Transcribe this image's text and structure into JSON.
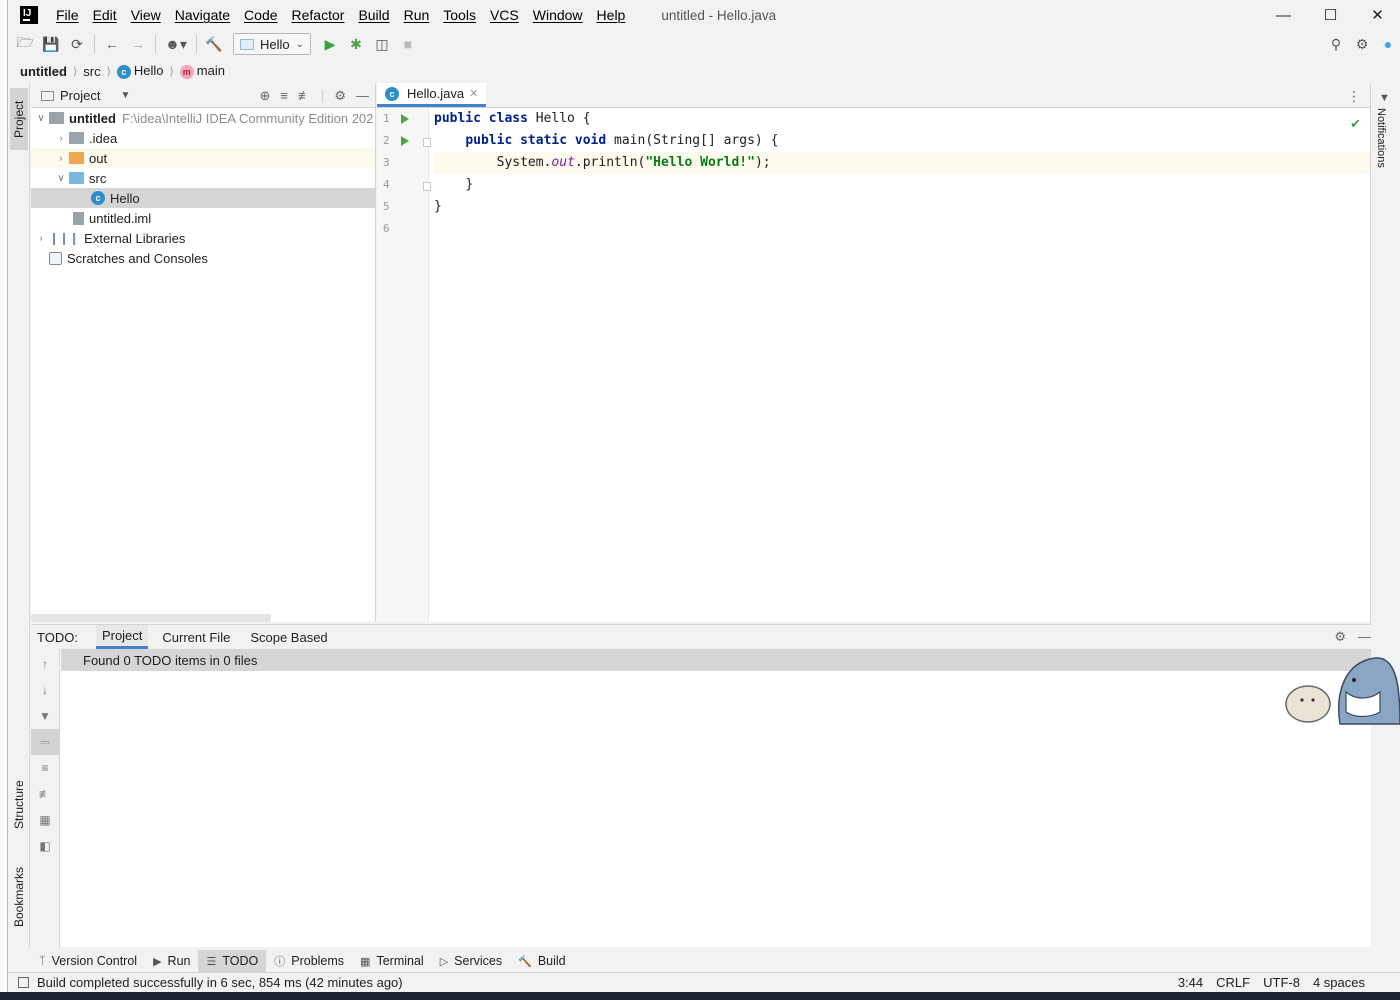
{
  "window": {
    "title": "untitled - Hello.java"
  },
  "menu": [
    "File",
    "Edit",
    "View",
    "Navigate",
    "Code",
    "Refactor",
    "Build",
    "Run",
    "Tools",
    "VCS",
    "Window",
    "Help"
  ],
  "toolbar": {
    "run_config": "Hello"
  },
  "breadcrumb": {
    "project": "untitled",
    "folder": "src",
    "class": "Hello",
    "method": "main"
  },
  "project_panel": {
    "title": "Project",
    "tree": [
      {
        "label": "untitled",
        "path": "F:\\idea\\IntelliJ IDEA Community Edition 202",
        "indent": 0
      },
      {
        "label": ".idea",
        "indent": 1
      },
      {
        "label": "out",
        "indent": 1
      },
      {
        "label": "src",
        "indent": 1
      },
      {
        "label": "Hello",
        "indent": 2
      },
      {
        "label": "untitled.iml",
        "indent": 1
      },
      {
        "label": "External Libraries",
        "indent": 0
      },
      {
        "label": "Scratches and Consoles",
        "indent": 0
      }
    ]
  },
  "editor": {
    "tab": "Hello.java",
    "line_numbers": [
      "1",
      "2",
      "3",
      "4",
      "5",
      "6"
    ],
    "code": {
      "l1_kw": "public class",
      "l1_rest": " Hello {",
      "l2_kw": "public static void",
      "l2_rest": " main(String[] args) {",
      "l3_a": "System.",
      "l3_field": "out",
      "l3_b": ".println(",
      "l3_str": "\"Hello World!\"",
      "l3_c": ");",
      "l4": "}",
      "l5": "}"
    }
  },
  "side_tabs": {
    "project": "Project",
    "structure": "Structure",
    "bookmarks": "Bookmarks",
    "notifications": "Notifications"
  },
  "todo": {
    "label": "TODO:",
    "tabs": [
      "Project",
      "Current File",
      "Scope Based"
    ],
    "result": "Found 0 TODO items in 0 files"
  },
  "bottom_tabs": [
    "Version Control",
    "Run",
    "TODO",
    "Problems",
    "Terminal",
    "Services",
    "Build"
  ],
  "status": {
    "message": "Build completed successfully in 6 sec, 854 ms (42 minutes ago)",
    "position": "3:44",
    "line_sep": "CRLF",
    "encoding": "UTF-8",
    "indent": "4 spaces"
  }
}
